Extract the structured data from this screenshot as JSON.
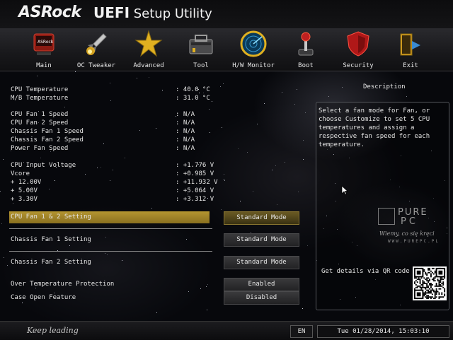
{
  "header": {
    "brand": "ASRock",
    "product_bold": "UEFI",
    "product_rest": " Setup Utility"
  },
  "nav": [
    {
      "label": "Main",
      "icon": "main-icon"
    },
    {
      "label": "OC Tweaker",
      "icon": "rocket-icon"
    },
    {
      "label": "Advanced",
      "icon": "star-icon"
    },
    {
      "label": "Tool",
      "icon": "toolbox-icon"
    },
    {
      "label": "H/W Monitor",
      "icon": "radar-icon"
    },
    {
      "label": "Boot",
      "icon": "joystick-icon"
    },
    {
      "label": "Security",
      "icon": "shield-icon"
    },
    {
      "label": "Exit",
      "icon": "exit-door-icon"
    }
  ],
  "readings": {
    "temperatures": [
      {
        "label": "CPU Temperature",
        "value": ": 40.0 °C"
      },
      {
        "label": "M/B Temperature",
        "value": ": 31.0 °C"
      }
    ],
    "fans": [
      {
        "label": "CPU Fan 1 Speed",
        "value": ": N/A"
      },
      {
        "label": "CPU Fan 2 Speed",
        "value": ": N/A"
      },
      {
        "label": "Chassis Fan 1 Speed",
        "value": ": N/A"
      },
      {
        "label": "Chassis Fan 2 Speed",
        "value": ": N/A"
      },
      {
        "label": "Power Fan Speed",
        "value": ": N/A"
      }
    ],
    "voltages": [
      {
        "label": "CPU Input Voltage",
        "value": ": +1.776 V"
      },
      {
        "label": "Vcore",
        "value": ": +0.985 V"
      },
      {
        "label": "+ 12.00V",
        "value": ": +11.932 V"
      },
      {
        "label": "+ 5.00V",
        "value": ": +5.064 V"
      },
      {
        "label": "+ 3.30V",
        "value": ": +3.312 V"
      }
    ]
  },
  "settings": [
    {
      "label": "CPU Fan 1 & 2 Setting",
      "value": "Standard Mode"
    },
    {
      "label": "Chassis Fan 1 Setting",
      "value": "Standard Mode"
    },
    {
      "label": "Chassis Fan 2 Setting",
      "value": "Standard Mode"
    },
    {
      "label": "Over Temperature Protection",
      "value": "Enabled"
    },
    {
      "label": "Case Open Feature",
      "value": "Disabled"
    }
  ],
  "description": {
    "title": "Description",
    "text": "Select a fan mode for Fan, or choose Customize to set 5 CPU temperatures and assign a respective fan speed for each temperature.",
    "qr_label": "Get details via QR code"
  },
  "watermark": {
    "pure": "PURE",
    "pc": "PC",
    "slogan": "Wiemy, co się kręci",
    "url": "WWW.PUREPC.PL"
  },
  "footer": {
    "tagline": "Keep leading",
    "language": "EN",
    "datetime": "Tue 01/28/2014, 15:03:10"
  },
  "colors": {
    "highlight": "#b49530",
    "accent_gold": "#d8b040"
  }
}
